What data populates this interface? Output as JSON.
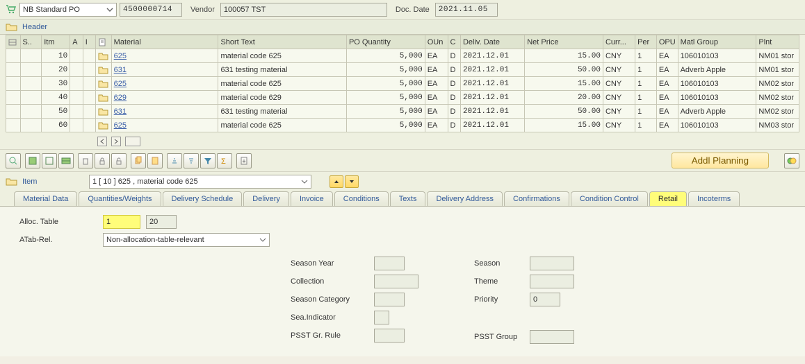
{
  "header": {
    "doc_type": "NB Standard PO",
    "doc_number": "4500000714",
    "vendor_label": "Vendor",
    "vendor_value": "100057 TST",
    "doc_date_label": "Doc. Date",
    "doc_date_value": "2021.11.05",
    "header_label": "Header"
  },
  "table": {
    "cols": [
      "S..",
      "Itm",
      "A",
      "I",
      "",
      "Material",
      "Short Text",
      "PO Quantity",
      "OUn",
      "C",
      "Deliv. Date",
      "Net Price",
      "Curr...",
      "Per",
      "OPU",
      "Matl Group",
      "Plnt"
    ],
    "rows": [
      {
        "itm": "10",
        "material": "625",
        "short": "material code 625",
        "qty": "5,000",
        "oun": "EA",
        "c": "D",
        "deliv": "2021.12.01",
        "price": "15.00",
        "curr": "CNY",
        "per": "1",
        "opu": "EA",
        "matl": "106010103",
        "plnt": "NM01 stor"
      },
      {
        "itm": "20",
        "material": "631",
        "short": "631 testing material",
        "qty": "5,000",
        "oun": "EA",
        "c": "D",
        "deliv": "2021.12.01",
        "price": "50.00",
        "curr": "CNY",
        "per": "1",
        "opu": "EA",
        "matl": "Adverb Apple",
        "plnt": "NM01 stor"
      },
      {
        "itm": "30",
        "material": "625",
        "short": "material code 625",
        "qty": "5,000",
        "oun": "EA",
        "c": "D",
        "deliv": "2021.12.01",
        "price": "15.00",
        "curr": "CNY",
        "per": "1",
        "opu": "EA",
        "matl": "106010103",
        "plnt": "NM02 stor"
      },
      {
        "itm": "40",
        "material": "629",
        "short": "material code 629",
        "qty": "5,000",
        "oun": "EA",
        "c": "D",
        "deliv": "2021.12.01",
        "price": "20.00",
        "curr": "CNY",
        "per": "1",
        "opu": "EA",
        "matl": "106010103",
        "plnt": "NM02 stor"
      },
      {
        "itm": "50",
        "material": "631",
        "short": "631 testing material",
        "qty": "5,000",
        "oun": "EA",
        "c": "D",
        "deliv": "2021.12.01",
        "price": "50.00",
        "curr": "CNY",
        "per": "1",
        "opu": "EA",
        "matl": "Adverb Apple",
        "plnt": "NM02 stor"
      },
      {
        "itm": "60",
        "material": "625",
        "short": "material code 625",
        "qty": "5,000",
        "oun": "EA",
        "c": "D",
        "deliv": "2021.12.01",
        "price": "15.00",
        "curr": "CNY",
        "per": "1",
        "opu": "EA",
        "matl": "106010103",
        "plnt": "NM03 stor"
      }
    ]
  },
  "toolbar": {
    "addl_planning": "Addl Planning"
  },
  "item_section": {
    "label": "Item",
    "selected": "1 [ 10 ] 625 , material code 625"
  },
  "tabs": [
    "Material Data",
    "Quantities/Weights",
    "Delivery Schedule",
    "Delivery",
    "Invoice",
    "Conditions",
    "Texts",
    "Delivery Address",
    "Confirmations",
    "Condition Control",
    "Retail",
    "Incoterms"
  ],
  "retail": {
    "alloc_table_label": "Alloc. Table",
    "alloc_table_v1": "1",
    "alloc_table_v2": "20",
    "atab_rel_label": "ATab-Rel.",
    "atab_rel_value": "Non-allocation-table-relevant",
    "season_year_label": "Season Year",
    "season_label": "Season",
    "collection_label": "Collection",
    "theme_label": "Theme",
    "season_cat_label": "Season Category",
    "priority_label": "Priority",
    "priority_value": "0",
    "sea_indicator_label": "Sea.Indicator",
    "psst_gr_rule_label": "PSST Gr. Rule",
    "psst_group_label": "PSST Group"
  }
}
